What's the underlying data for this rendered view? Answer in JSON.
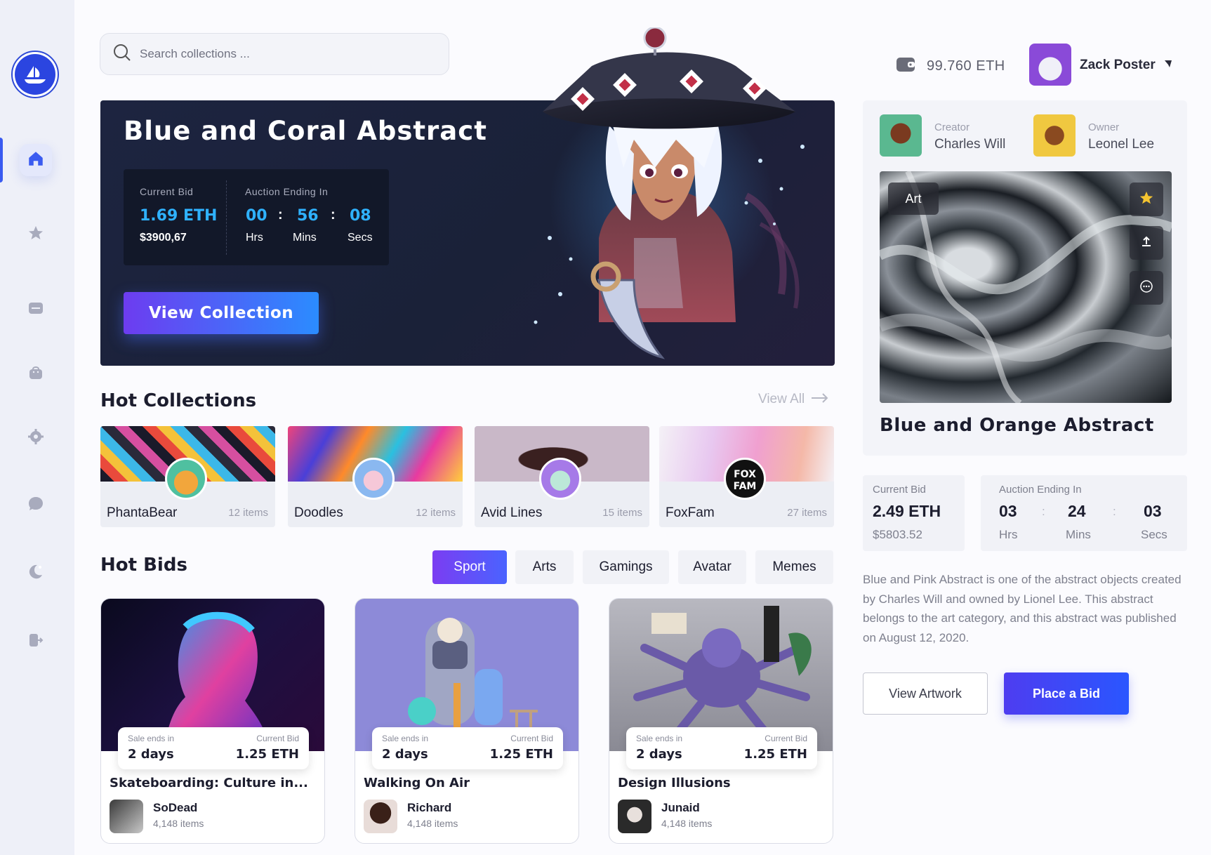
{
  "search": {
    "placeholder": "Search collections ..."
  },
  "hero": {
    "title": "Blue and Coral Abstract",
    "current_bid_label": "Current Bid",
    "current_bid_eth": "1.69 ETH",
    "current_bid_usd": "$3900,67",
    "auction_label": "Auction Ending In",
    "hours": "00",
    "minutes": "56",
    "seconds": "08",
    "hours_label": "Hrs",
    "minutes_label": "Mins",
    "seconds_label": "Secs",
    "button_label": "View Collection"
  },
  "hot_collections": {
    "title": "Hot Collections",
    "view_all": "View All",
    "items": [
      {
        "name": "PhantaBear",
        "count": "12 items"
      },
      {
        "name": "Doodles",
        "count": "12 items"
      },
      {
        "name": "Avid Lines",
        "count": "15 items"
      },
      {
        "name": "FoxFam",
        "count": "27 items"
      }
    ]
  },
  "hot_bids": {
    "title": "Hot Bids",
    "tabs": [
      "Sport",
      "Arts",
      "Gamings",
      "Avatar",
      "Memes"
    ],
    "active_tab": "Sport",
    "sale_label": "Sale ends in",
    "bid_label": "Current Bid",
    "cards": [
      {
        "title": "Skateboarding: Culture in...",
        "sale": "2 days",
        "bid": "1.25 ETH",
        "user": "SoDead",
        "items": "4,148 items"
      },
      {
        "title": "Walking On Air",
        "sale": "2 days",
        "bid": "1.25 ETH",
        "user": "Richard",
        "items": "4,148 items"
      },
      {
        "title": "Design Illusions",
        "sale": "2 days",
        "bid": "1.25 ETH",
        "user": "Junaid",
        "items": "4,148 items"
      }
    ]
  },
  "wallet": {
    "balance": "99.760 ETH"
  },
  "profile": {
    "name": "Zack Poster"
  },
  "detail": {
    "creator_label": "Creator",
    "creator": "Charles Will",
    "owner_label": "Owner",
    "owner": "Leonel Lee",
    "tag": "Art",
    "title": "Blue and Orange Abstract",
    "current_bid_label": "Current Bid",
    "current_bid_eth": "2.49 ETH",
    "current_bid_usd": "$5803.52",
    "auction_label": "Auction Ending In",
    "hours": "03",
    "minutes": "24",
    "seconds": "03",
    "hours_label": "Hrs",
    "minutes_label": "Mins",
    "seconds_label": "Secs",
    "description": "Blue and Pink Abstract is one of the abstract objects created by Charles Will and owned by Lionel Lee. This abstract belongs to the art category, and this abstract was published on August 12, 2020.",
    "view_artwork": "View Artwork",
    "place_bid": "Place a Bid"
  },
  "colors": {
    "accent_blue": "#2fb2ff",
    "accent_purple": "#6d3cf0",
    "brand": "#2b45e0"
  }
}
